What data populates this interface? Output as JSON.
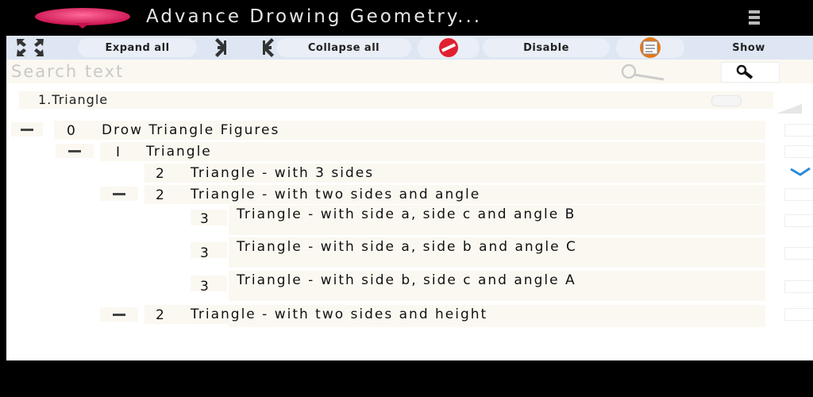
{
  "app": {
    "title": "Advance Drowing Geometry...",
    "brand_color": "#e0185a"
  },
  "toolbar": {
    "expand_label": "Expand all",
    "collapse_label": "Collapse all",
    "disable_label": "Disable",
    "show_label": "Show",
    "icons": [
      "expand-arrows-icon",
      "collapse-arrows-icon",
      "no-entry-icon",
      "document-icon"
    ]
  },
  "search": {
    "placeholder": "Search text",
    "value": ""
  },
  "dropdown": {
    "selected": "1.Triangle"
  },
  "tree": [
    {
      "level": "0",
      "label": "Drow Triangle Figures",
      "expanded": true
    },
    {
      "level": "I",
      "label": "Triangle",
      "expanded": true
    },
    {
      "level": "2",
      "label": "Triangle - with 3 sides",
      "checked": true
    },
    {
      "level": "2",
      "label": "Triangle - with two sides and angle",
      "expanded": true
    },
    {
      "level": "3",
      "label": "Triangle - with side a, side c and angle B"
    },
    {
      "level": "3",
      "label": "Triangle - with side a, side b and angle C"
    },
    {
      "level": "3",
      "label": "Triangle - with side b, side c and angle A"
    },
    {
      "level": "2",
      "label": "Triangle - with two sides and height",
      "expanded": true
    }
  ]
}
